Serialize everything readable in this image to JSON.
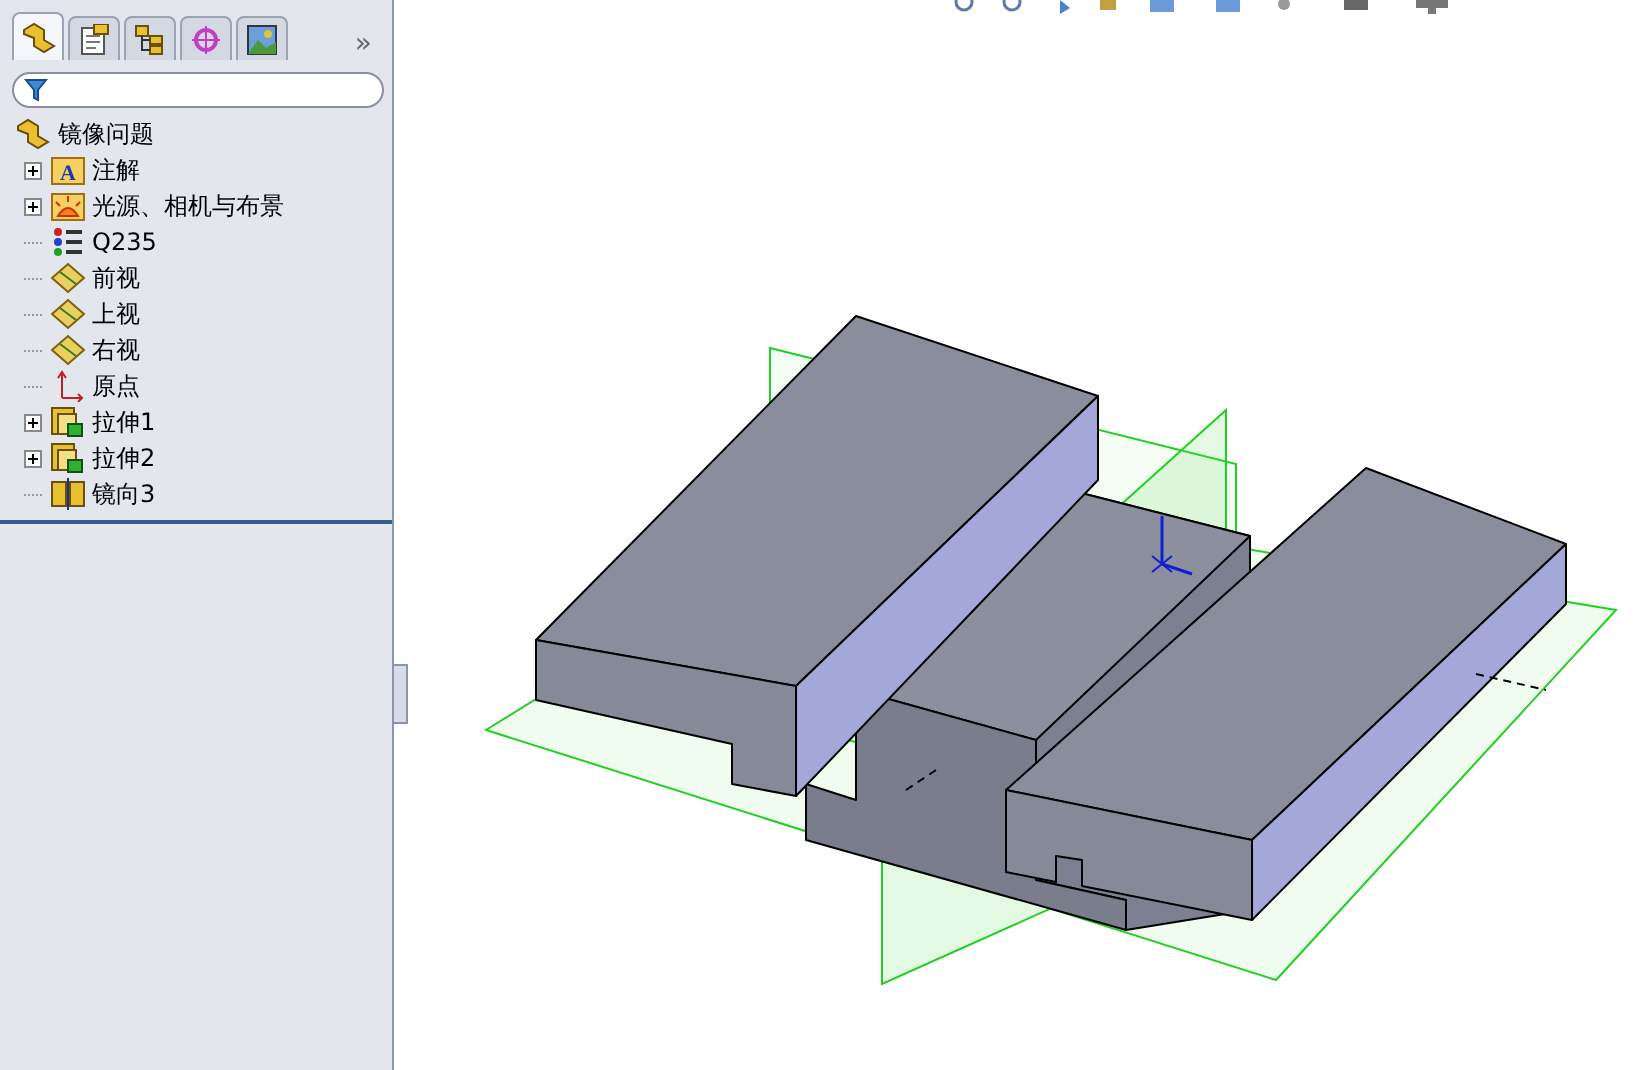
{
  "tabs": [
    {
      "kind": "feature",
      "selected": true
    },
    {
      "kind": "property",
      "selected": false
    },
    {
      "kind": "config",
      "selected": false
    },
    {
      "kind": "target",
      "selected": false
    },
    {
      "kind": "display",
      "selected": false
    }
  ],
  "more_tabs": "»",
  "tree": {
    "root": "镜像问题",
    "items": [
      {
        "label": "注解",
        "kind": "annotation",
        "expandable": true,
        "icon_letter": "A"
      },
      {
        "label": "光源、相机与布景",
        "kind": "lights",
        "expandable": true
      },
      {
        "label": "Q235",
        "kind": "material",
        "expandable": false
      },
      {
        "label": "前视",
        "kind": "plane",
        "expandable": false
      },
      {
        "label": "上视",
        "kind": "plane",
        "expandable": false
      },
      {
        "label": "右视",
        "kind": "plane",
        "expandable": false
      },
      {
        "label": "原点",
        "kind": "origin",
        "expandable": false
      },
      {
        "label": "拉伸1",
        "kind": "extrude",
        "expandable": true
      },
      {
        "label": "拉伸2",
        "kind": "extrude",
        "expandable": true
      },
      {
        "label": "镜向3",
        "kind": "mirror",
        "expandable": false
      }
    ]
  }
}
